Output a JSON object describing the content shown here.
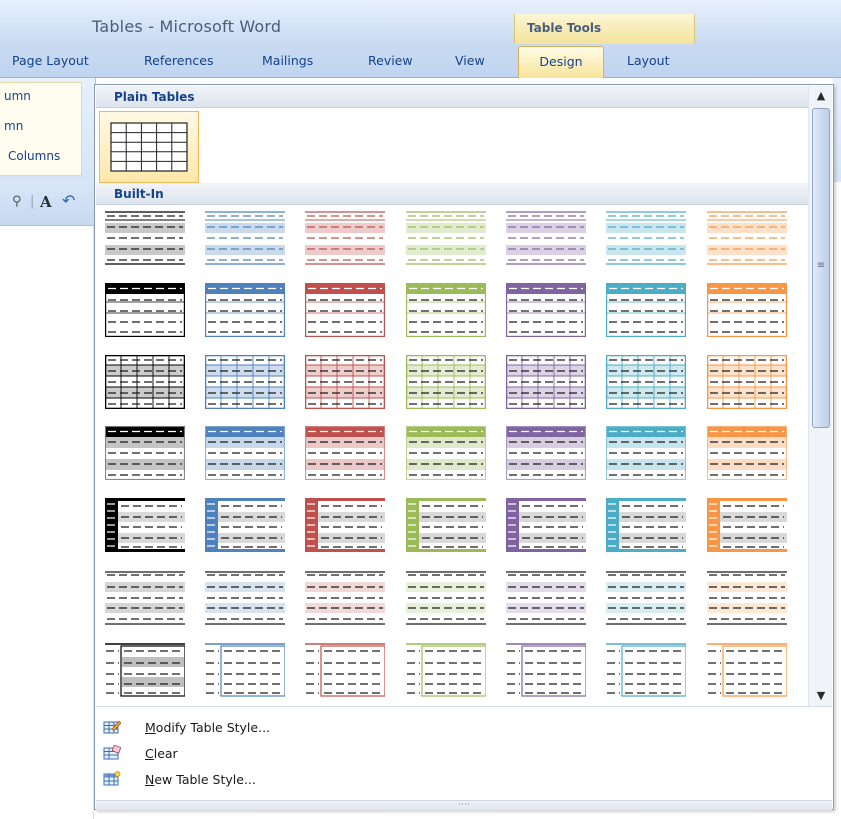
{
  "window": {
    "title": "Tables - Microsoft Word"
  },
  "contextual_group": {
    "label": "Table Tools"
  },
  "tabs": [
    {
      "label": "Page Layout"
    },
    {
      "label": "References"
    },
    {
      "label": "Mailings"
    },
    {
      "label": "Review"
    },
    {
      "label": "View"
    },
    {
      "label": "Design",
      "selected": true
    },
    {
      "label": "Layout"
    }
  ],
  "ribbon_left": {
    "items": [
      "umn",
      "mn",
      "Columns"
    ]
  },
  "gallery": {
    "sections": [
      {
        "label": "Plain Tables"
      },
      {
        "label": "Built-In"
      }
    ],
    "palette": [
      "#000000",
      "#4f81bd",
      "#c0504d",
      "#9bbb59",
      "#8064a2",
      "#4bacc6",
      "#f79646"
    ],
    "style_rows": [
      "light-shading",
      "light-list",
      "light-grid",
      "medium-shading-1",
      "medium-list-1",
      "colorful-list",
      "table-grid-accent"
    ]
  },
  "menu": {
    "items": [
      {
        "label": "Modify Table Style...",
        "icon": "modify-table-style-icon",
        "accel": "M",
        "rest": "odify Table Style..."
      },
      {
        "label": "Clear",
        "icon": "clear-table-style-icon",
        "accel": "C",
        "rest": "lear"
      },
      {
        "label": "New Table Style...",
        "icon": "new-table-style-icon",
        "accel": "N",
        "rest": "ew Table Style..."
      }
    ]
  }
}
